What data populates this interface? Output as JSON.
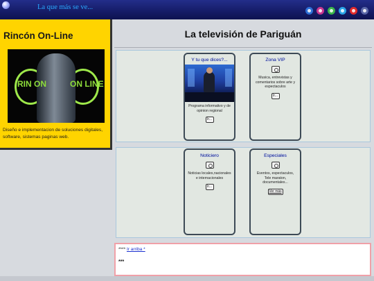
{
  "header": {
    "tagline": "La que más se ve...",
    "social_icons": [
      {
        "name": "facebook-icon",
        "color": "#2d6fd6"
      },
      {
        "name": "instagram-icon",
        "color": "#c8368f"
      },
      {
        "name": "whatsapp-icon",
        "color": "#3bb54a"
      },
      {
        "name": "twitter-icon",
        "color": "#2aa4e6"
      },
      {
        "name": "youtube-icon",
        "color": "#e02a2a"
      },
      {
        "name": "contact-icon",
        "color": "#5a67a8"
      }
    ]
  },
  "sidebar": {
    "title": "Rincón On-Line",
    "banner_text_left": "RIN ON",
    "banner_text_right": "ON LINE",
    "description": "Diseño e implementacion de soluciones digitales, software, sistemas paginas web."
  },
  "main": {
    "title": "La televisión de Pariguán",
    "cards": [
      {
        "title": "Y tu que dices?...",
        "desc": "Programa informativo y de opinion regional",
        "button": "Ir..."
      },
      {
        "title": "Zona VIP",
        "desc": "Musica, entrevistas y comentarios sobre arte y espectaculos",
        "button": "Ir..."
      },
      {
        "title": "Noticiero",
        "desc": "Noticias locales,nacionales e internacionales",
        "button": "Ir..."
      },
      {
        "title": "Especiales",
        "desc": "Eventos, espectaculos, Tele maraton, documentales...",
        "button": "Ver más"
      }
    ]
  },
  "footer": {
    "prefix": "****",
    "link": "Ir arriba *",
    "line2": "***"
  }
}
